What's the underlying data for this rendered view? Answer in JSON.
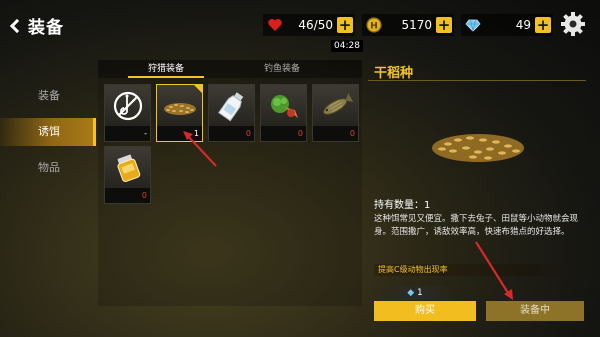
{
  "header": {
    "back_title": "装备",
    "timer": "04:28"
  },
  "resources": [
    {
      "name": "health",
      "icon": "heart-icon",
      "value": "46/50",
      "color": "#d81e1e"
    },
    {
      "name": "coins",
      "icon": "coin-icon",
      "value": "5170",
      "color": "#e3b21c"
    },
    {
      "name": "diamonds",
      "icon": "diamond-icon",
      "value": "49",
      "color": "#79c8f2"
    }
  ],
  "sidebar": {
    "items": [
      {
        "label": "装备",
        "active": false
      },
      {
        "label": "诱饵",
        "active": true
      },
      {
        "label": "物品",
        "active": false
      }
    ]
  },
  "tabs": [
    {
      "label": "狩猎装备",
      "active": true
    },
    {
      "label": "钓鱼装备",
      "active": false
    }
  ],
  "items": [
    {
      "icon": "disabled-lure-icon",
      "count": "-"
    },
    {
      "icon": "rice-seeds-icon",
      "count": "1",
      "selected": true
    },
    {
      "icon": "milk-bottle-icon",
      "count": "0"
    },
    {
      "icon": "vegetables-icon",
      "count": "0"
    },
    {
      "icon": "dried-fish-icon",
      "count": "0"
    },
    {
      "icon": "honey-jar-icon",
      "count": "0"
    }
  ],
  "detail": {
    "name": "干稻种",
    "quantity": "持有数量：1",
    "description": "这种饵常见又便宜。撒下去兔子、田鼠等小动物就会现身。范围撒广，诱敌效率高，快速布猎点的好选择。",
    "effect": "提高C级动物出现率",
    "price": "1",
    "buy_label": "购买",
    "equip_label": "装备中"
  },
  "colors": {
    "accent": "#f3c226",
    "count_zero": "#e53b2b",
    "annotation_arrow": "#d42a2a"
  }
}
